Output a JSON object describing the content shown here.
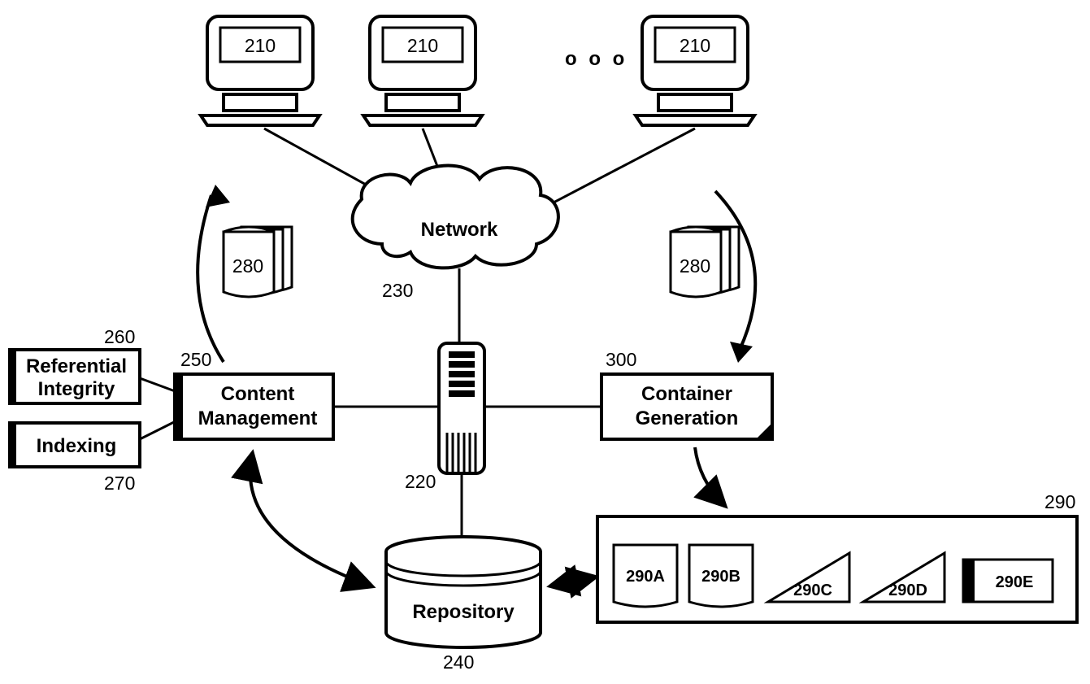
{
  "clients": {
    "ref": "210",
    "ellipsis": "o o o"
  },
  "network": {
    "label": "Network",
    "ref": "230"
  },
  "server": {
    "ref": "220"
  },
  "content_mgmt": {
    "label1": "Content",
    "label2": "Management",
    "ref": "250"
  },
  "ref_integrity": {
    "label1": "Referential",
    "label2": "Integrity",
    "ref": "260"
  },
  "indexing": {
    "label": "Indexing",
    "ref": "270"
  },
  "container_gen": {
    "label1": "Container",
    "label2": "Generation",
    "ref": "300"
  },
  "documents_left": {
    "ref": "280"
  },
  "documents_right": {
    "ref": "280"
  },
  "repository": {
    "label": "Repository",
    "ref": "240"
  },
  "container_box": {
    "ref": "290",
    "items": {
      "a": "290A",
      "b": "290B",
      "c": "290C",
      "d": "290D",
      "e": "290E"
    }
  }
}
